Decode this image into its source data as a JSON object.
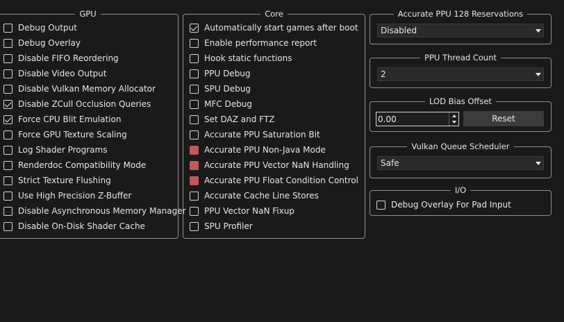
{
  "gpu": {
    "title": "GPU",
    "items": [
      {
        "label": "Debug Output",
        "state": "unchecked"
      },
      {
        "label": "Debug Overlay",
        "state": "unchecked"
      },
      {
        "label": "Disable FIFO Reordering",
        "state": "unchecked"
      },
      {
        "label": "Disable Video Output",
        "state": "unchecked"
      },
      {
        "label": "Disable Vulkan Memory Allocator",
        "state": "unchecked"
      },
      {
        "label": "Disable ZCull Occlusion Queries",
        "state": "checked"
      },
      {
        "label": "Force CPU Blit Emulation",
        "state": "checked"
      },
      {
        "label": "Force GPU Texture Scaling",
        "state": "unchecked"
      },
      {
        "label": "Log Shader Programs",
        "state": "unchecked"
      },
      {
        "label": "Renderdoc Compatibility Mode",
        "state": "unchecked"
      },
      {
        "label": "Strict Texture Flushing",
        "state": "unchecked"
      },
      {
        "label": "Use High Precision Z-Buffer",
        "state": "unchecked"
      },
      {
        "label": "Disable Asynchronous Memory Manager",
        "state": "unchecked"
      },
      {
        "label": "Disable On-Disk Shader Cache",
        "state": "unchecked"
      }
    ]
  },
  "core": {
    "title": "Core",
    "items": [
      {
        "label": "Automatically start games after boot",
        "state": "checked"
      },
      {
        "label": "Enable performance report",
        "state": "unchecked"
      },
      {
        "label": "Hook static functions",
        "state": "unchecked"
      },
      {
        "label": "PPU Debug",
        "state": "unchecked"
      },
      {
        "label": "SPU Debug",
        "state": "unchecked"
      },
      {
        "label": "MFC Debug",
        "state": "unchecked"
      },
      {
        "label": "Set DAZ and FTZ",
        "state": "unchecked"
      },
      {
        "label": "Accurate PPU Saturation Bit",
        "state": "unchecked"
      },
      {
        "label": "Accurate PPU Non-Java Mode",
        "state": "highlighted"
      },
      {
        "label": "Accurate PPU Vector NaN Handling",
        "state": "highlighted"
      },
      {
        "label": "Accurate PPU Float Condition Control",
        "state": "highlighted"
      },
      {
        "label": "Accurate Cache Line Stores",
        "state": "unchecked"
      },
      {
        "label": "PPU Vector NaN Fixup",
        "state": "unchecked"
      },
      {
        "label": "SPU Profiler",
        "state": "unchecked"
      }
    ]
  },
  "ppu_reservations": {
    "title": "Accurate PPU 128 Reservations",
    "value": "Disabled"
  },
  "ppu_threads": {
    "title": "PPU Thread Count",
    "value": "2"
  },
  "lod_bias": {
    "title": "LOD Bias Offset",
    "value": "0.00",
    "reset_label": "Reset"
  },
  "vulkan_queue": {
    "title": "Vulkan Queue Scheduler",
    "value": "Safe"
  },
  "io": {
    "title": "I/O",
    "items": [
      {
        "label": "Debug Overlay For Pad Input",
        "state": "unchecked"
      }
    ]
  },
  "colors": {
    "background": "#1a1a1a",
    "highlight": "#c0585e",
    "border": "#8f8f8f"
  }
}
